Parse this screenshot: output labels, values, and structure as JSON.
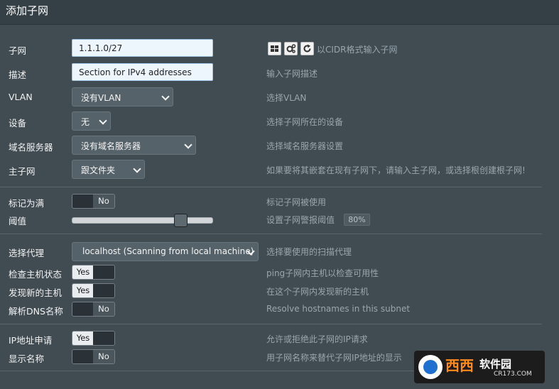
{
  "title": "添加子网",
  "fields": {
    "subnet": {
      "label": "子网",
      "value": "1.1.1.0/27",
      "hint": "以CIDR格式输入子网"
    },
    "description": {
      "label": "描述",
      "value": "Section for IPv4 addresses",
      "hint": "输入子网描述"
    },
    "vlan": {
      "label": "VLAN",
      "value": "没有VLAN",
      "hint": "选择VLAN"
    },
    "device": {
      "label": "设备",
      "value": "无",
      "hint": "选择子网所在的设备"
    },
    "nameserver": {
      "label": "域名服务器",
      "value": "没有域名服务器",
      "hint": "选择域名服务器设置"
    },
    "master": {
      "label": "主子网",
      "value": "跟文件夹",
      "hint": "如果要将其嵌套在现有子网下，请输入主子网，或选择根创建根子网!"
    },
    "mark_full": {
      "label": "标记为满",
      "state": "No",
      "hint": "标记子网被使用"
    },
    "threshold": {
      "label": "阈值",
      "hint": "设置子网警报阈值",
      "percent": 80,
      "badge": "80%"
    },
    "scan_agent": {
      "label": "选择代理",
      "value": "localhost (Scanning from local machine)",
      "hint": "选择要使用的扫描代理"
    },
    "check_hosts": {
      "label": "检查主机状态",
      "state": "Yes",
      "hint": "ping子网内主机以检查可用性"
    },
    "discover_hosts": {
      "label": "发现新的主机",
      "state": "Yes",
      "hint": "在这个子网内发现新的主机"
    },
    "resolve_dns": {
      "label": "解析DNS名称",
      "state": "No",
      "hint": "Resolve hostnames in this subnet"
    },
    "ip_requests": {
      "label": "IP地址申请",
      "state": "Yes",
      "hint": "允许或拒绝此子网的IP请求"
    },
    "show_name": {
      "label": "显示名称",
      "state": "No",
      "hint": "用子网名称来替代子网IP地址的显示"
    }
  },
  "icons": [
    "grid-icon",
    "gears-icon",
    "refresh-icon"
  ],
  "watermark": {
    "brand": "西西",
    "text": "软件园",
    "url": "CR173.COM"
  },
  "colors": {
    "background": "#404b52",
    "input": "#eef6fd",
    "hint": "#9aa6ad"
  }
}
